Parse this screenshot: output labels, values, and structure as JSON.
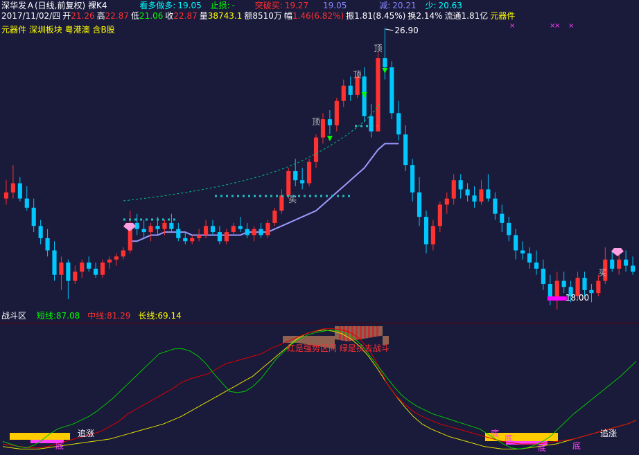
{
  "header": {
    "stock_title": "深华发Ａ(日线,前复权) 裸K4",
    "bull_bear_label": "看多做多:",
    "bull_bear_value": "19.05",
    "stop_loss_label": "止损:",
    "stop_loss_value": "-",
    "breakout_buy_label": "突破买:",
    "breakout_buy_value": "19.27",
    "sep_value": "19.05",
    "reduce_label": "减:",
    "reduce_value": "20.21",
    "less_label": "少:",
    "less_value": "20.63"
  },
  "quote": {
    "date": "2017/11/02/四",
    "open_label": "开",
    "open": "21.26",
    "high_label": "高",
    "high": "22.87",
    "low_label": "低",
    "low": "21.06",
    "close_label": "收",
    "close": "22.87",
    "volume_label": "量",
    "volume": "38743.1",
    "amount_label": "额",
    "amount": "8510万",
    "change_label": "幅",
    "change": "1.46(6.82%)",
    "amplitude_label": "振",
    "amplitude": "1.81(8.45%)",
    "turnover_label": "换",
    "turnover": "2.14%",
    "float_label": "流通",
    "float": "1.81亿",
    "sector": "元器件"
  },
  "tags": {
    "line": "元器件 深圳板块 粤港澳 含B股"
  },
  "annotations": {
    "high_price": "26.90",
    "low_price": "18.00",
    "top_label": "顶",
    "buy_label": "买",
    "buy2_label": "买",
    "zhui_label": "追涨",
    "di_label": "底",
    "red_text": "红是强势区间 绿是扶去战斗"
  },
  "indicator": {
    "name": "战斗区",
    "short_label": "短线:",
    "short_value": "87.08",
    "mid_label": "中线:",
    "mid_value": "81.29",
    "long_label": "长线:",
    "long_value": "69.14"
  },
  "colors": {
    "up": "#ff3232",
    "down": "#00c8ff",
    "bg": "#1a1a3a",
    "ma": "#9b9bff",
    "short": "#00c800",
    "mid": "#e00000",
    "long": "#e0e000"
  },
  "chart_data": {
    "type": "candlestick",
    "price_range": [
      18.0,
      26.9
    ],
    "candles": [
      [
        21.3,
        21.9,
        21.1,
        21.5
      ],
      [
        21.5,
        22.4,
        21.3,
        21.8
      ],
      [
        21.8,
        22.0,
        21.2,
        21.3
      ],
      [
        21.3,
        21.7,
        20.9,
        21.0
      ],
      [
        21.0,
        21.3,
        20.2,
        20.4
      ],
      [
        20.4,
        20.6,
        19.8,
        20.0
      ],
      [
        20.0,
        20.3,
        19.4,
        19.6
      ],
      [
        19.6,
        19.9,
        18.6,
        18.8
      ],
      [
        18.8,
        19.4,
        18.3,
        19.2
      ],
      [
        19.2,
        19.3,
        18.0,
        18.6
      ],
      [
        18.6,
        19.1,
        18.5,
        18.9
      ],
      [
        18.9,
        19.3,
        18.7,
        19.2
      ],
      [
        19.2,
        19.4,
        18.9,
        19.0
      ],
      [
        19.0,
        19.2,
        18.7,
        18.8
      ],
      [
        18.8,
        19.3,
        18.7,
        19.2
      ],
      [
        19.2,
        19.4,
        19.0,
        19.3
      ],
      [
        19.3,
        19.5,
        19.1,
        19.4
      ],
      [
        19.4,
        19.7,
        19.3,
        19.6
      ],
      [
        19.6,
        20.9,
        19.5,
        20.5
      ],
      [
        20.5,
        20.8,
        20.1,
        20.3
      ],
      [
        20.3,
        20.6,
        20.0,
        20.2
      ],
      [
        20.2,
        20.5,
        19.9,
        20.4
      ],
      [
        20.4,
        20.7,
        20.1,
        20.3
      ],
      [
        20.3,
        20.6,
        20.1,
        20.5
      ],
      [
        20.5,
        20.8,
        20.2,
        20.3
      ],
      [
        20.3,
        20.5,
        19.9,
        20.0
      ],
      [
        20.0,
        20.2,
        19.8,
        19.9
      ],
      [
        19.9,
        20.1,
        19.8,
        20.0
      ],
      [
        20.0,
        20.3,
        19.9,
        20.1
      ],
      [
        20.1,
        20.6,
        20.0,
        20.4
      ],
      [
        20.4,
        20.6,
        20.1,
        20.2
      ],
      [
        20.2,
        20.4,
        19.8,
        19.9
      ],
      [
        19.9,
        20.3,
        19.8,
        20.2
      ],
      [
        20.2,
        20.5,
        20.1,
        20.4
      ],
      [
        20.4,
        20.7,
        20.2,
        20.3
      ],
      [
        20.3,
        20.5,
        20.0,
        20.1
      ],
      [
        20.1,
        20.4,
        19.9,
        20.3
      ],
      [
        20.3,
        20.5,
        20.0,
        20.1
      ],
      [
        20.1,
        20.6,
        20.0,
        20.5
      ],
      [
        20.5,
        21.0,
        20.4,
        20.9
      ],
      [
        20.9,
        21.6,
        20.8,
        21.4
      ],
      [
        21.4,
        22.3,
        21.3,
        22.2
      ],
      [
        22.2,
        22.6,
        21.7,
        21.9
      ],
      [
        21.9,
        22.3,
        21.6,
        21.8
      ],
      [
        21.8,
        22.6,
        21.7,
        22.5
      ],
      [
        22.5,
        23.4,
        22.3,
        23.3
      ],
      [
        23.3,
        24.1,
        23.1,
        23.9
      ],
      [
        23.9,
        24.2,
        23.4,
        23.7
      ],
      [
        23.7,
        24.6,
        23.5,
        24.5
      ],
      [
        24.5,
        25.2,
        24.3,
        25.0
      ],
      [
        25.0,
        25.3,
        24.5,
        24.7
      ],
      [
        24.7,
        25.3,
        24.6,
        25.3
      ],
      [
        25.3,
        25.6,
        23.8,
        24.0
      ],
      [
        24.0,
        24.4,
        23.3,
        23.5
      ],
      [
        23.5,
        26.1,
        23.5,
        25.9
      ],
      [
        25.9,
        26.9,
        25.2,
        25.6
      ],
      [
        25.6,
        25.8,
        23.9,
        24.1
      ],
      [
        24.1,
        24.5,
        23.2,
        23.4
      ],
      [
        23.4,
        23.7,
        22.2,
        22.4
      ],
      [
        22.4,
        22.6,
        21.2,
        21.5
      ],
      [
        21.5,
        22.0,
        20.4,
        20.7
      ],
      [
        20.7,
        20.9,
        19.5,
        19.8
      ],
      [
        19.8,
        20.6,
        19.6,
        20.4
      ],
      [
        20.4,
        21.2,
        20.2,
        21.1
      ],
      [
        21.1,
        21.5,
        20.8,
        21.3
      ],
      [
        21.3,
        22.1,
        21.1,
        21.9
      ],
      [
        21.9,
        22.1,
        21.3,
        21.6
      ],
      [
        21.6,
        21.8,
        21.2,
        21.4
      ],
      [
        21.4,
        21.7,
        21.0,
        21.2
      ],
      [
        21.2,
        21.9,
        21.1,
        21.6
      ],
      [
        21.6,
        22.1,
        21.2,
        21.3
      ],
      [
        21.3,
        21.5,
        20.6,
        20.8
      ],
      [
        20.8,
        21.1,
        20.2,
        20.5
      ],
      [
        20.5,
        20.7,
        19.9,
        20.1
      ],
      [
        20.1,
        20.3,
        19.3,
        19.6
      ],
      [
        19.6,
        19.9,
        19.3,
        19.5
      ],
      [
        19.5,
        19.7,
        19.0,
        19.2
      ],
      [
        19.2,
        19.6,
        18.8,
        19.0
      ],
      [
        19.0,
        19.3,
        18.3,
        18.5
      ],
      [
        18.5,
        18.8,
        17.8,
        18.0
      ],
      [
        18.0,
        18.9,
        17.6,
        18.6
      ],
      [
        18.6,
        18.9,
        18.2,
        18.4
      ],
      [
        18.4,
        18.6,
        17.9,
        18.1
      ],
      [
        18.1,
        18.9,
        18.0,
        18.7
      ],
      [
        18.7,
        18.9,
        18.1,
        18.3
      ],
      [
        18.3,
        18.5,
        17.9,
        18.2
      ],
      [
        18.2,
        18.8,
        18.1,
        18.6
      ],
      [
        18.6,
        19.7,
        18.5,
        19.3
      ],
      [
        19.3,
        19.6,
        18.9,
        19.0
      ],
      [
        19.0,
        19.5,
        18.8,
        19.3
      ],
      [
        19.3,
        19.6,
        18.9,
        19.1
      ],
      [
        19.1,
        19.4,
        18.8,
        18.9
      ]
    ],
    "ma": [
      null,
      null,
      null,
      null,
      null,
      null,
      null,
      null,
      null,
      null,
      null,
      null,
      null,
      null,
      null,
      null,
      null,
      null,
      19.9,
      19.9,
      20.0,
      20.1,
      20.1,
      20.2,
      20.2,
      20.2,
      20.2,
      20.1,
      20.1,
      20.1,
      20.1,
      20.1,
      20.1,
      20.1,
      20.1,
      20.2,
      20.2,
      20.2,
      20.2,
      20.3,
      20.4,
      20.5,
      20.6,
      20.7,
      20.8,
      20.9,
      21.1,
      21.3,
      21.5,
      21.7,
      21.9,
      22.1,
      22.3,
      22.6,
      22.9,
      23.1,
      23.1,
      23.1,
      null,
      null,
      null,
      null,
      null,
      null,
      null,
      null,
      null,
      null,
      null,
      null,
      null,
      null,
      null,
      null,
      null,
      null,
      null,
      null,
      null,
      null,
      null,
      null,
      null,
      null,
      null,
      null,
      null,
      null,
      null,
      null,
      null,
      null
    ],
    "indicator_range": [
      0,
      100
    ],
    "short_line": [
      8,
      6,
      4,
      3,
      5,
      9,
      14,
      18,
      20,
      22,
      25,
      28,
      32,
      37,
      42,
      48,
      54,
      60,
      66,
      72,
      78,
      80,
      82,
      82,
      80,
      76,
      70,
      62,
      55,
      48,
      47,
      48,
      52,
      58,
      66,
      74,
      80,
      86,
      90,
      93,
      95,
      96,
      97,
      96,
      94,
      90,
      84,
      76,
      68,
      60,
      52,
      45,
      40,
      36,
      33,
      30,
      28,
      26,
      24,
      22,
      20,
      18,
      14,
      10,
      6,
      3,
      2,
      3,
      5,
      8,
      12,
      18,
      24,
      30,
      35,
      40,
      45,
      50,
      55,
      60,
      66,
      72
    ],
    "mid_line": [
      6,
      5,
      4,
      3,
      3,
      4,
      6,
      8,
      10,
      12,
      14,
      16,
      20,
      24,
      30,
      34,
      38,
      42,
      46,
      50,
      55,
      58,
      60,
      62,
      66,
      70,
      72,
      74,
      76,
      78,
      82,
      85,
      88,
      91,
      94,
      96,
      98,
      98,
      97,
      95,
      90,
      82,
      70,
      55,
      45,
      38,
      32,
      28,
      25,
      22,
      20,
      18,
      16,
      14,
      12,
      10,
      8,
      7,
      6,
      6,
      6,
      7,
      8,
      9,
      10,
      12,
      14,
      16,
      18,
      20,
      22,
      25
    ],
    "long_line": [
      4,
      3,
      2,
      2,
      2,
      3,
      4,
      5,
      6,
      7,
      8,
      9,
      10,
      12,
      14,
      16,
      18,
      20,
      22,
      25,
      28,
      32,
      36,
      40,
      44,
      48,
      52,
      56,
      60,
      66,
      72,
      78,
      84,
      90,
      94,
      96,
      97,
      96,
      94,
      90,
      84,
      76,
      66,
      55,
      45,
      36,
      28,
      22,
      18,
      15,
      12,
      10,
      8,
      6,
      4,
      3,
      2,
      2,
      2,
      3,
      4,
      5,
      6,
      8,
      10,
      12,
      14,
      16,
      18,
      20,
      22,
      25
    ]
  }
}
